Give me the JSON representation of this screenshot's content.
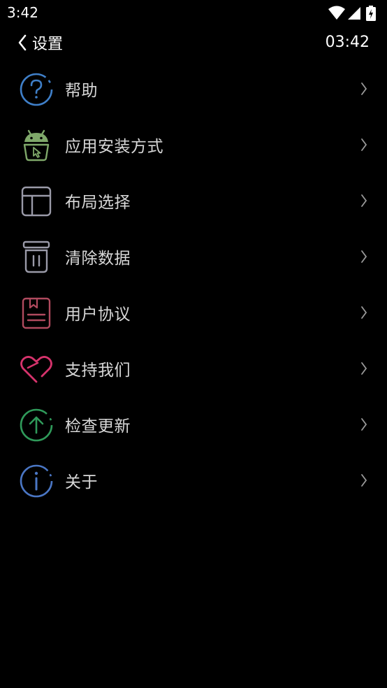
{
  "status_bar": {
    "time": "3:42",
    "icons": [
      "wifi-icon",
      "signal-icon",
      "battery-icon"
    ]
  },
  "app_bar": {
    "title": "设置",
    "clock": "03:42",
    "back_icon": "chevron-left-icon"
  },
  "colors": {
    "background": "#000000",
    "help": "#3f7fc8",
    "install": "#7fa86a",
    "layout": "#9a9aa8",
    "clear": "#9a9aa8",
    "agreement": "#b04a5e",
    "support": "#d6336c",
    "update": "#2f9a5a",
    "about": "#4a76c4"
  },
  "settings": {
    "items": [
      {
        "label": "帮助",
        "icon": "help-icon"
      },
      {
        "label": "应用安装方式",
        "icon": "android-install-icon"
      },
      {
        "label": "布局选择",
        "icon": "layout-icon"
      },
      {
        "label": "清除数据",
        "icon": "trash-icon"
      },
      {
        "label": "用户协议",
        "icon": "document-icon"
      },
      {
        "label": "支持我们",
        "icon": "heart-icon"
      },
      {
        "label": "检查更新",
        "icon": "upload-icon"
      },
      {
        "label": "关于",
        "icon": "info-icon"
      }
    ]
  }
}
